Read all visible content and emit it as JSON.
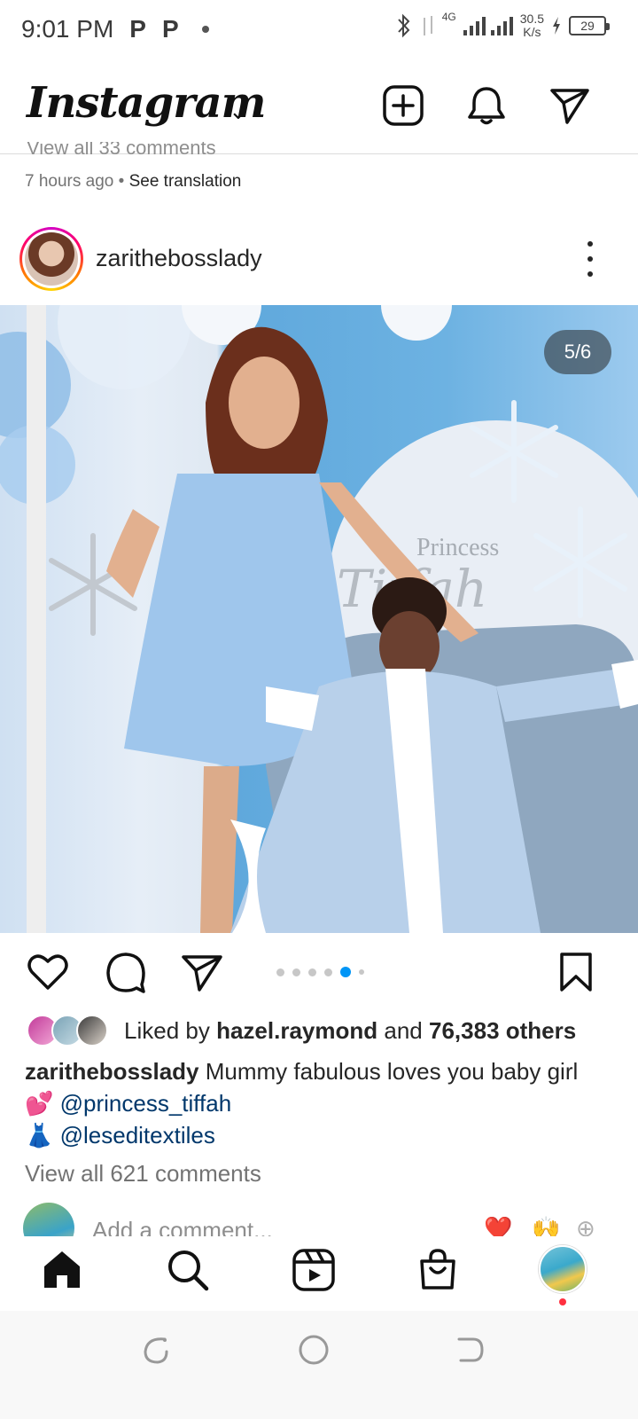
{
  "status_bar": {
    "time": "9:01 PM",
    "notif_icons": [
      "P",
      "P"
    ],
    "signal": "4G",
    "net_speed": "30.5",
    "net_speed_unit": "K/s",
    "battery": "29"
  },
  "header": {
    "logo": "Instagram",
    "icons": [
      "new-post-icon",
      "notifications-icon",
      "direct-message-icon"
    ]
  },
  "previous_post": {
    "cut_text": "View all 33 comments",
    "time_ago": "7 hours ago",
    "separator": "•",
    "see_translation": "See translation"
  },
  "post": {
    "username": "zarithebosslady",
    "image_counter": "5/6",
    "carousel": {
      "total": 6,
      "active": 5
    },
    "likes": {
      "prefix": "Liked by",
      "user": "hazel.raymond",
      "and": "and",
      "others": "76,383 others"
    },
    "caption": {
      "username": "zarithebosslady",
      "text": "Mummy fabulous loves you baby girl",
      "line2_emoji": "💕",
      "mention1": "@princess_tiffah",
      "line3_emoji": "👗",
      "mention2": "@leseditextiles"
    },
    "comments_link": "View all 621 comments",
    "add_comment_placeholder": "Add a comment...",
    "quick_reactions": [
      "❤️",
      "🙌",
      "⊕"
    ]
  },
  "bottom_nav": {
    "items": [
      "home-icon",
      "search-icon",
      "reels-icon",
      "shop-icon",
      "profile-avatar"
    ]
  },
  "colors": {
    "link_blue": "#00376b",
    "accent_blue": "#0095f6",
    "notification_red": "#ff3040"
  }
}
